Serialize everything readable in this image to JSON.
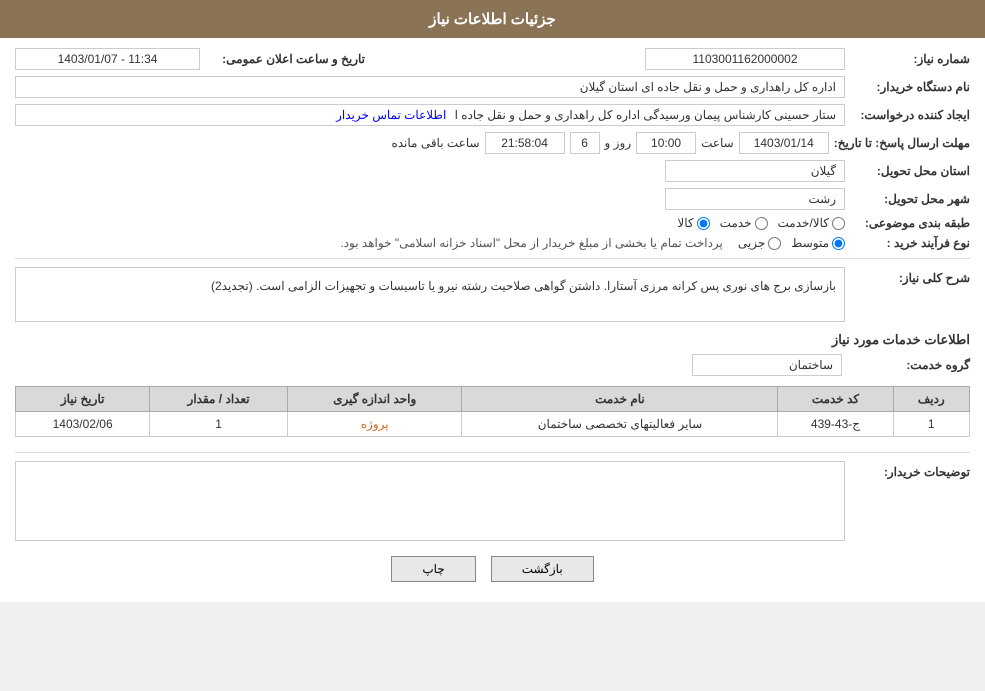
{
  "header": {
    "title": "جزئیات اطلاعات نیاز"
  },
  "fields": {
    "need_number_label": "شماره نیاز:",
    "need_number_value": "1103001162000002",
    "buyer_org_label": "نام دستگاه خریدار:",
    "buyer_org_value": "اداره کل راهداری و حمل و نقل جاده ای استان گیلان",
    "creator_label": "ایجاد کننده درخواست:",
    "creator_value": "ستار حسینی کارشناس پیمان ورسیدگی اداره کل راهداری و حمل و نقل جاده ا‌",
    "creator_link": "اطلاعات تماس خریدار",
    "reply_deadline_label": "مهلت ارسال پاسخ: تا تاریخ:",
    "deadline_date": "1403/01/14",
    "deadline_time_label": "ساعت",
    "deadline_time": "10:00",
    "deadline_day_label": "روز و",
    "deadline_days": "6",
    "deadline_remaining": "21:58:04",
    "deadline_remaining_suffix": "ساعت باقی مانده",
    "province_label": "استان محل تحویل:",
    "province_value": "گیلان",
    "city_label": "شهر محل تحویل:",
    "city_value": "رشت",
    "category_label": "طبقه بندی موضوعی:",
    "category_options": [
      "کالا",
      "خدمت",
      "کالا/خدمت"
    ],
    "category_selected": "کالا",
    "purchase_type_label": "نوع فرآیند خرید :",
    "purchase_type_options": [
      "جزیی",
      "متوسط"
    ],
    "purchase_type_selected": "متوسط",
    "purchase_type_note": "پرداخت تمام یا بخشی از مبلغ خریدار از محل \"اسناد خزانه اسلامی\" خواهد بود.",
    "general_desc_label": "شرح کلی نیاز:",
    "general_desc_value": "بازسازی برج های نوری پس کرانه مرزی آستارا. داشتن گواهی صلاحیت رشته نیرو یا تاسیسات و تجهیزات الزامی است. (تجدید2)",
    "services_section_title": "اطلاعات خدمات مورد نیاز",
    "service_group_label": "گروه خدمت:",
    "service_group_value": "ساختمان",
    "table": {
      "headers": [
        "ردیف",
        "کد خدمت",
        "نام خدمت",
        "واحد اندازه گیری",
        "تعداد / مقدار",
        "تاریخ نیاز"
      ],
      "rows": [
        {
          "row": "1",
          "code": "ج-43-439",
          "name": "سایر فعالیتهای تخصصی ساختمان",
          "unit": "پروژه",
          "quantity": "1",
          "date": "1403/02/06"
        }
      ]
    },
    "buyer_desc_label": "توضیحات خریدار:",
    "buyer_desc_value": "",
    "buttons": {
      "print": "چاپ",
      "back": "بازگشت"
    }
  }
}
